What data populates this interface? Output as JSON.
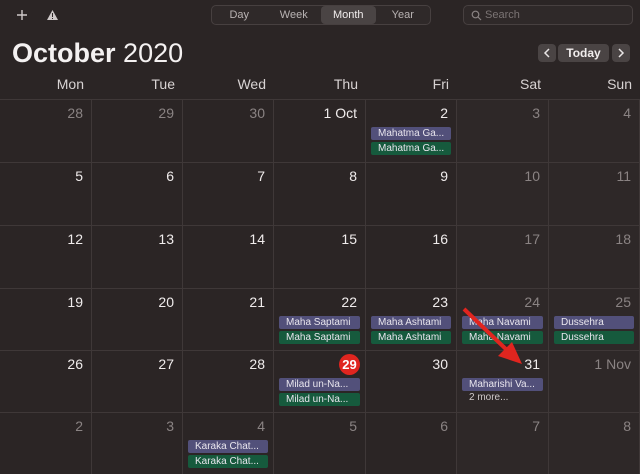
{
  "toolbar": {
    "add_icon": "plus-icon",
    "alert_icon": "warning-icon",
    "views": [
      "Day",
      "Week",
      "Month",
      "Year"
    ],
    "active_view": "Month",
    "search_placeholder": "Search"
  },
  "header": {
    "month": "October",
    "year": "2020",
    "today_label": "Today"
  },
  "weekdays": [
    "Mon",
    "Tue",
    "Wed",
    "Thu",
    "Fri",
    "Sat",
    "Sun"
  ],
  "weeks": [
    [
      {
        "label": "28",
        "dim": true
      },
      {
        "label": "29",
        "dim": true
      },
      {
        "label": "30",
        "dim": true
      },
      {
        "label": "1 Oct"
      },
      {
        "label": "2",
        "events": [
          {
            "t": "Mahatma Ga...",
            "c": "purple"
          },
          {
            "t": "Mahatma Ga...",
            "c": "green"
          }
        ]
      },
      {
        "label": "3",
        "dim": true
      },
      {
        "label": "4",
        "dim": true
      }
    ],
    [
      {
        "label": "5"
      },
      {
        "label": "6"
      },
      {
        "label": "7"
      },
      {
        "label": "8"
      },
      {
        "label": "9"
      },
      {
        "label": "10",
        "dim": true
      },
      {
        "label": "11",
        "dim": true
      }
    ],
    [
      {
        "label": "12"
      },
      {
        "label": "13"
      },
      {
        "label": "14"
      },
      {
        "label": "15"
      },
      {
        "label": "16"
      },
      {
        "label": "17",
        "dim": true
      },
      {
        "label": "18",
        "dim": true
      }
    ],
    [
      {
        "label": "19"
      },
      {
        "label": "20"
      },
      {
        "label": "21"
      },
      {
        "label": "22",
        "events": [
          {
            "t": "Maha Saptami",
            "c": "purple"
          },
          {
            "t": "Maha Saptami",
            "c": "green"
          }
        ]
      },
      {
        "label": "23",
        "events": [
          {
            "t": "Maha Ashtami",
            "c": "purple"
          },
          {
            "t": "Maha Ashtami",
            "c": "green"
          }
        ]
      },
      {
        "label": "24",
        "dim": true,
        "events": [
          {
            "t": "Maha Navami",
            "c": "purple"
          },
          {
            "t": "Maha Navami",
            "c": "green"
          }
        ]
      },
      {
        "label": "25",
        "dim": true,
        "events": [
          {
            "t": "Dussehra",
            "c": "purple"
          },
          {
            "t": "Dussehra",
            "c": "green"
          }
        ]
      }
    ],
    [
      {
        "label": "26"
      },
      {
        "label": "27"
      },
      {
        "label": "28"
      },
      {
        "label": "29",
        "today": true,
        "events": [
          {
            "t": "Milad un-Na...",
            "c": "purple"
          },
          {
            "t": "Milad un-Na...",
            "c": "green"
          }
        ]
      },
      {
        "label": "30"
      },
      {
        "label": "31",
        "events": [
          {
            "t": "Maharishi Va...",
            "c": "purple"
          }
        ],
        "more": "2 more..."
      },
      {
        "label": "1 Nov",
        "dim": true
      }
    ],
    [
      {
        "label": "2",
        "dim": true
      },
      {
        "label": "3",
        "dim": true
      },
      {
        "label": "4",
        "dim": true,
        "events": [
          {
            "t": "Karaka Chat...",
            "c": "purple"
          },
          {
            "t": "Karaka Chat...",
            "c": "green"
          }
        ]
      },
      {
        "label": "5",
        "dim": true
      },
      {
        "label": "6",
        "dim": true
      },
      {
        "label": "7",
        "dim": true
      },
      {
        "label": "8",
        "dim": true
      }
    ]
  ],
  "colors": {
    "accent_today": "#e0251f",
    "event_purple": "#52507a",
    "event_green": "#165a3d",
    "annotation_arrow": "#e0251f"
  }
}
